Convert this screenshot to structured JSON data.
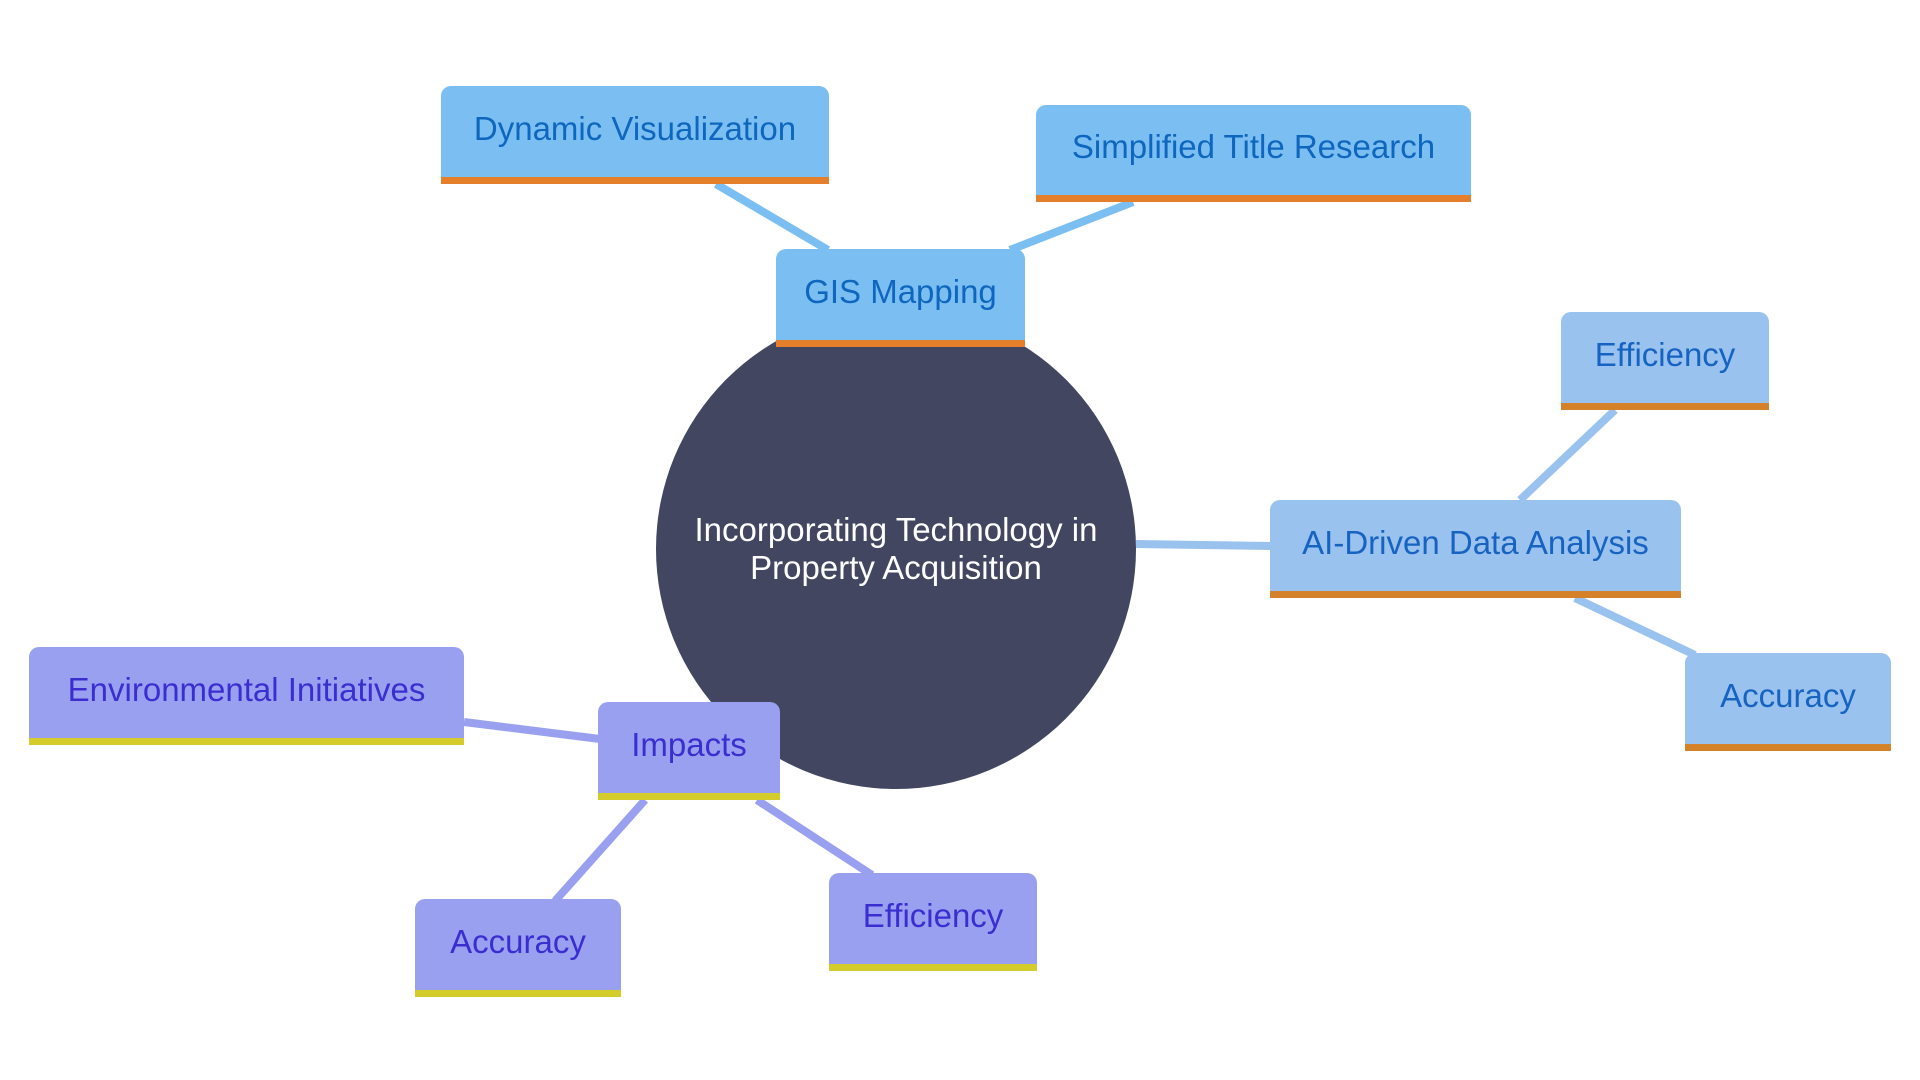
{
  "diagram": {
    "type": "mindmap",
    "root": {
      "label": "Incorporating Technology in Property Acquisition",
      "color": "#424660"
    },
    "branches": [
      {
        "id": "gis",
        "label": "GIS Mapping",
        "fill": "#7BBFF2",
        "accent": "#E57F2B",
        "text_color": "#0E66BE",
        "edge_color": "#7BBFF2",
        "children": [
          {
            "label": "Dynamic Visualization"
          },
          {
            "label": "Simplified Title Research"
          }
        ]
      },
      {
        "id": "ai",
        "label": "AI-Driven Data Analysis",
        "fill": "#9AC2EE",
        "accent": "#D4812A",
        "text_color": "#1763C2",
        "edge_color": "#9AC2EE",
        "children": [
          {
            "label": "Efficiency"
          },
          {
            "label": "Accuracy"
          }
        ]
      },
      {
        "id": "impacts",
        "label": "Impacts",
        "fill": "#9AA0F0",
        "accent": "#D4CC2A",
        "text_color": "#3A2ED0",
        "edge_color": "#9AA0F0",
        "children": [
          {
            "label": "Environmental Initiatives"
          },
          {
            "label": "Accuracy"
          },
          {
            "label": "Efficiency"
          }
        ]
      }
    ]
  }
}
